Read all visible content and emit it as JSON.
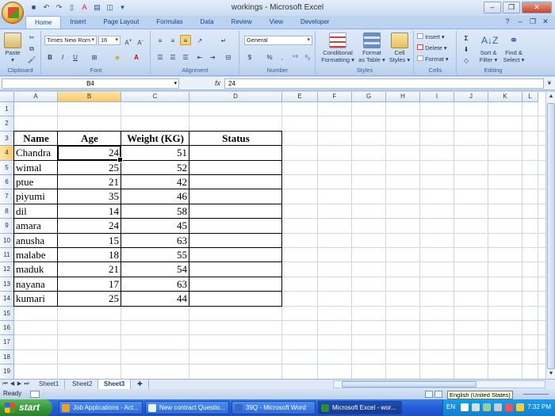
{
  "window": {
    "title": "workings - Microsoft Excel"
  },
  "ribbon": {
    "tabs": [
      "Home",
      "Insert",
      "Page Layout",
      "Formulas",
      "Data",
      "Review",
      "View",
      "Developer"
    ],
    "active_tab": "Home",
    "clipboard": {
      "label": "Clipboard",
      "paste": "Paste"
    },
    "font": {
      "label": "Font",
      "name": "Times New Rom",
      "size": "16"
    },
    "alignment": {
      "label": "Alignment"
    },
    "number": {
      "label": "Number",
      "format": "General"
    },
    "styles": {
      "label": "Styles",
      "conditional": "Conditional",
      "conditional2": "Formatting ▾",
      "format_table": "Format",
      "format_table2": "as Table ▾",
      "cell_styles": "Cell",
      "cell_styles2": "Styles ▾"
    },
    "cells": {
      "label": "Cells",
      "insert": "Insert ▾",
      "delete": "Delete ▾",
      "format": "Format ▾"
    },
    "editing": {
      "label": "Editing",
      "sort": "Sort &",
      "sort2": "Filter ▾",
      "find": "Find &",
      "find2": "Select ▾"
    }
  },
  "formula_bar": {
    "name_box": "B4",
    "fx": "fx",
    "value": "24"
  },
  "columns": [
    "A",
    "B",
    "C",
    "D",
    "E",
    "F",
    "G",
    "H",
    "I",
    "J",
    "K",
    "L"
  ],
  "selected_column": "B",
  "rows": [
    "1",
    "2",
    "3",
    "4",
    "5",
    "6",
    "7",
    "8",
    "9",
    "10",
    "11",
    "12",
    "13",
    "14",
    "15",
    "16",
    "17",
    "18",
    "19"
  ],
  "selected_row": "4",
  "table": {
    "headers": [
      "Name",
      "Age",
      "Weight (KG)",
      "Status"
    ],
    "rows": [
      [
        "Chandra",
        "24",
        "51",
        ""
      ],
      [
        "wimal",
        "25",
        "52",
        ""
      ],
      [
        "ptue",
        "21",
        "42",
        ""
      ],
      [
        "piyumi",
        "35",
        "46",
        ""
      ],
      [
        "dil",
        "14",
        "58",
        ""
      ],
      [
        "amara",
        "24",
        "45",
        ""
      ],
      [
        "anusha",
        "15",
        "63",
        ""
      ],
      [
        "malabe",
        "18",
        "55",
        ""
      ],
      [
        "maduk",
        "21",
        "54",
        ""
      ],
      [
        "nayana",
        "17",
        "63",
        ""
      ],
      [
        "kumari",
        "25",
        "44",
        ""
      ]
    ]
  },
  "sheets": [
    "Sheet1",
    "Sheet2",
    "Sheet3"
  ],
  "active_sheet": "Sheet3",
  "status": {
    "text": "Ready",
    "tooltip": "English (United States)"
  },
  "taskbar": {
    "start": "start",
    "tasks": [
      "Job Applications - Act...",
      "New contract Questio...",
      "39Q - Microsoft Word",
      "Microsoft Excel - wor..."
    ],
    "active_task": 3,
    "lang": "EN",
    "clock": "7:32 PM"
  },
  "colors": {
    "accent": "#15428b",
    "selection": "#f9c86a",
    "taskbar": "#245edb"
  }
}
